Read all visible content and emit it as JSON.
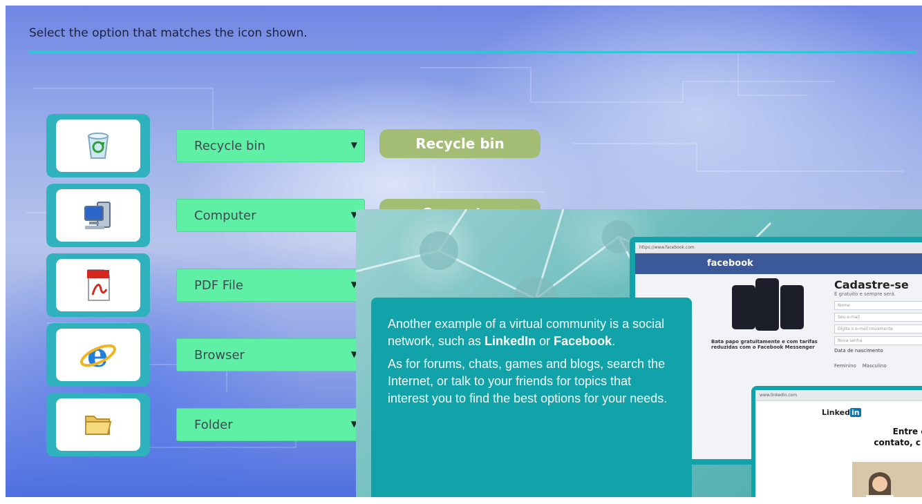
{
  "instruction": "Select the option that matches the icon shown.",
  "rows": [
    {
      "icon": "recycle-bin-icon",
      "selected": "Recycle bin",
      "answer": "Recycle bin"
    },
    {
      "icon": "computer-icon",
      "selected": "Computer",
      "answer": "Computer"
    },
    {
      "icon": "pdf-file-icon",
      "selected": "PDF File",
      "answer": ""
    },
    {
      "icon": "browser-icon",
      "selected": "Browser",
      "answer": ""
    },
    {
      "icon": "folder-icon",
      "selected": "Folder",
      "answer": ""
    }
  ],
  "overlay": {
    "para1_before": "Another example of a virtual community is a social network, such as ",
    "para1_strong1": "LinkedIn",
    "para1_mid": " or ",
    "para1_strong2": "Facebook",
    "para1_end": ".",
    "para2": "As for forums, chats, games and blogs, search the Internet, or talk to your friends for topics that interest you to find the best options for your needs.",
    "facebook": {
      "logo": "facebook",
      "signup_title": "Cadastre-se",
      "signup_sub": "É gratuito e sempre será.",
      "tagline": "Bata papo gratuitamente e com tarifas reduzidas com o Facebook Messenger",
      "fields": [
        "Nome",
        "Seu e-mail",
        "Digite o e-mail novamente",
        "Nova senha"
      ],
      "birth_label": "Data de nascimento",
      "gender_female": "Feminino",
      "gender_male": "Masculino"
    },
    "linkedin": {
      "logo_text": "Linked",
      "logo_badge": "in",
      "headline": "Entre em contato, c op"
    }
  },
  "colors": {
    "accent": "#2ec7d6",
    "card": "#2fb2bd",
    "select": "#5ff0a6",
    "answer": "#a3bd74",
    "overlay_box": "#12a2a9",
    "facebook_blue": "#3b5998"
  }
}
